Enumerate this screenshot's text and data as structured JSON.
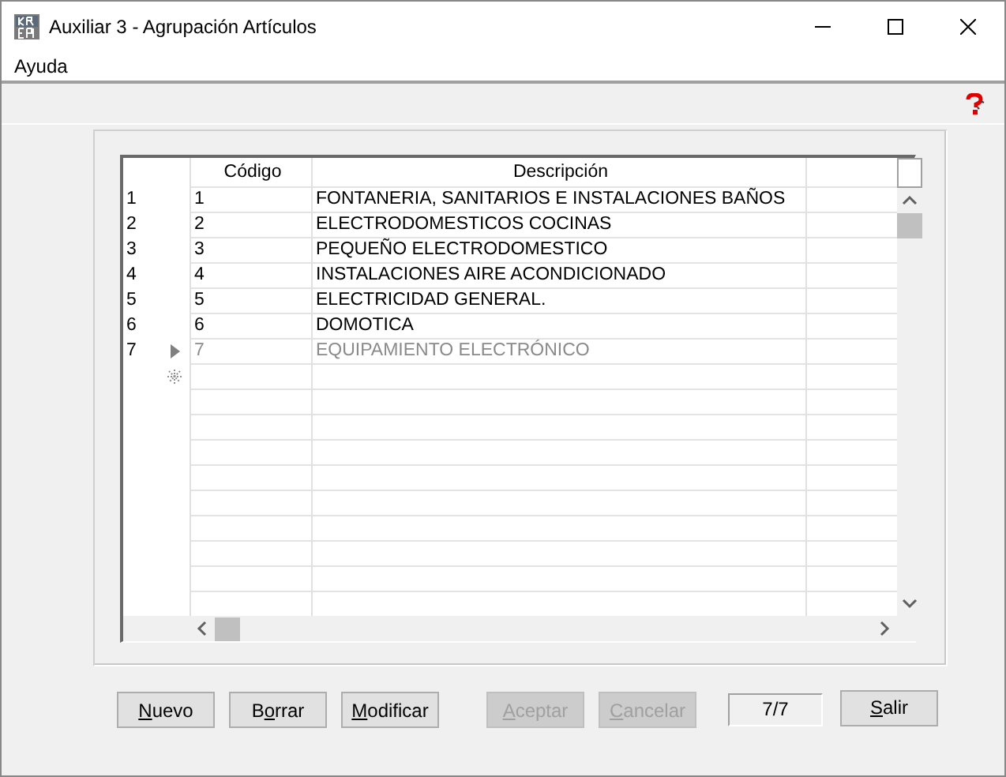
{
  "window": {
    "title": "Auxiliar 3 - Agrupación Artículos"
  },
  "menu": [
    "Ayuda"
  ],
  "table": {
    "columns": [
      "Código",
      "Descripción"
    ],
    "rows": [
      {
        "number": "1",
        "code": "1",
        "description": "FONTANERIA, SANITARIOS E INSTALACIONES BAÑOS",
        "current": false
      },
      {
        "number": "2",
        "code": "2",
        "description": "ELECTRODOMESTICOS COCINAS",
        "current": false
      },
      {
        "number": "3",
        "code": "3",
        "description": "PEQUEÑO ELECTRODOMESTICO",
        "current": false
      },
      {
        "number": "4",
        "code": "4",
        "description": "INSTALACIONES AIRE ACONDICIONADO",
        "current": false
      },
      {
        "number": "5",
        "code": "5",
        "description": "ELECTRICIDAD GENERAL.",
        "current": false
      },
      {
        "number": "6",
        "code": "6",
        "description": "DOMOTICA",
        "current": false
      },
      {
        "number": "7",
        "code": "7",
        "description": "EQUIPAMIENTO ELECTRÓNICO",
        "current": true
      }
    ]
  },
  "buttons": [
    {
      "label": [
        {
          "text": "N",
          "underline": true
        },
        {
          "text": "uevo",
          "underline": false
        }
      ],
      "disabled": false
    },
    {
      "label": [
        {
          "text": "B",
          "underline": false
        },
        {
          "text": "o",
          "underline": true
        },
        {
          "text": "rrar",
          "underline": false
        }
      ],
      "disabled": false
    },
    {
      "label": [
        {
          "text": "M",
          "underline": true
        },
        {
          "text": "odificar",
          "underline": false
        }
      ],
      "disabled": false
    },
    {
      "label": [
        {
          "text": "A",
          "underline": true
        },
        {
          "text": "ceptar",
          "underline": false
        }
      ],
      "disabled": true
    },
    {
      "label": [
        {
          "text": "C",
          "underline": true
        },
        {
          "text": "ancelar",
          "underline": false
        }
      ],
      "disabled": true
    }
  ],
  "record_counter": "7/7",
  "exit_button": {
    "label": [
      {
        "text": "S",
        "underline": true
      },
      {
        "text": "alir",
        "underline": false
      }
    ],
    "disabled": false
  }
}
